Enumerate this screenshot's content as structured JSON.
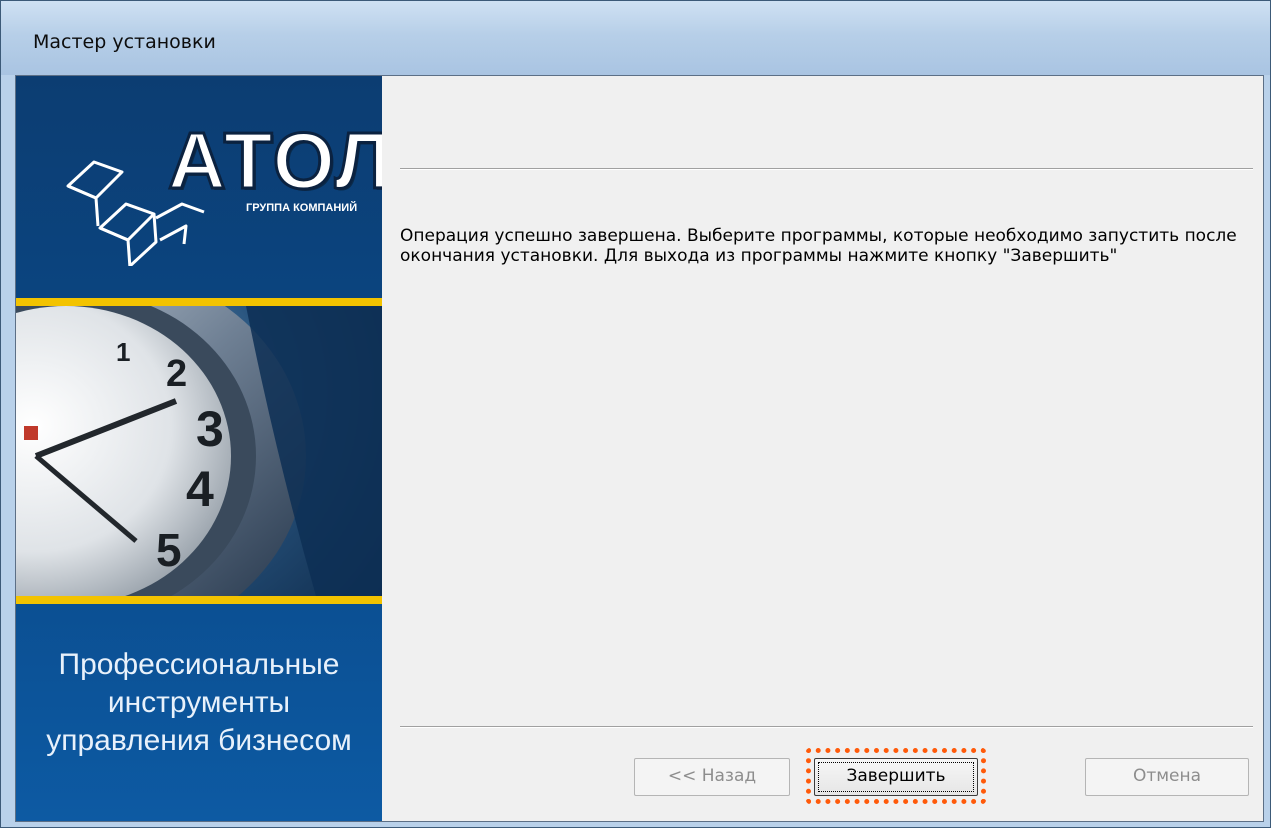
{
  "window": {
    "title": "Мастер установки"
  },
  "sidebar": {
    "logo": {
      "name": "АТОЛ",
      "tagline": "ГРУППА КОМПАНИЙ"
    },
    "slogan": [
      "Профессиональные",
      "инструменты",
      "управления бизнесом"
    ]
  },
  "content": {
    "message": "Операция успешно завершена. Выберите программы, которые необходимо запустить после окончания установки. Для выхода из программы нажмите кнопку \"Завершить\""
  },
  "buttons": {
    "back": {
      "label": "<< Назад",
      "enabled": false
    },
    "finish": {
      "label": "Завершить",
      "enabled": true
    },
    "cancel": {
      "label": "Отмена",
      "enabled": false
    }
  },
  "colors": {
    "highlight": "#ff5a0a",
    "brand_blue": "#0c3d72",
    "accent_yellow": "#f3c300"
  }
}
